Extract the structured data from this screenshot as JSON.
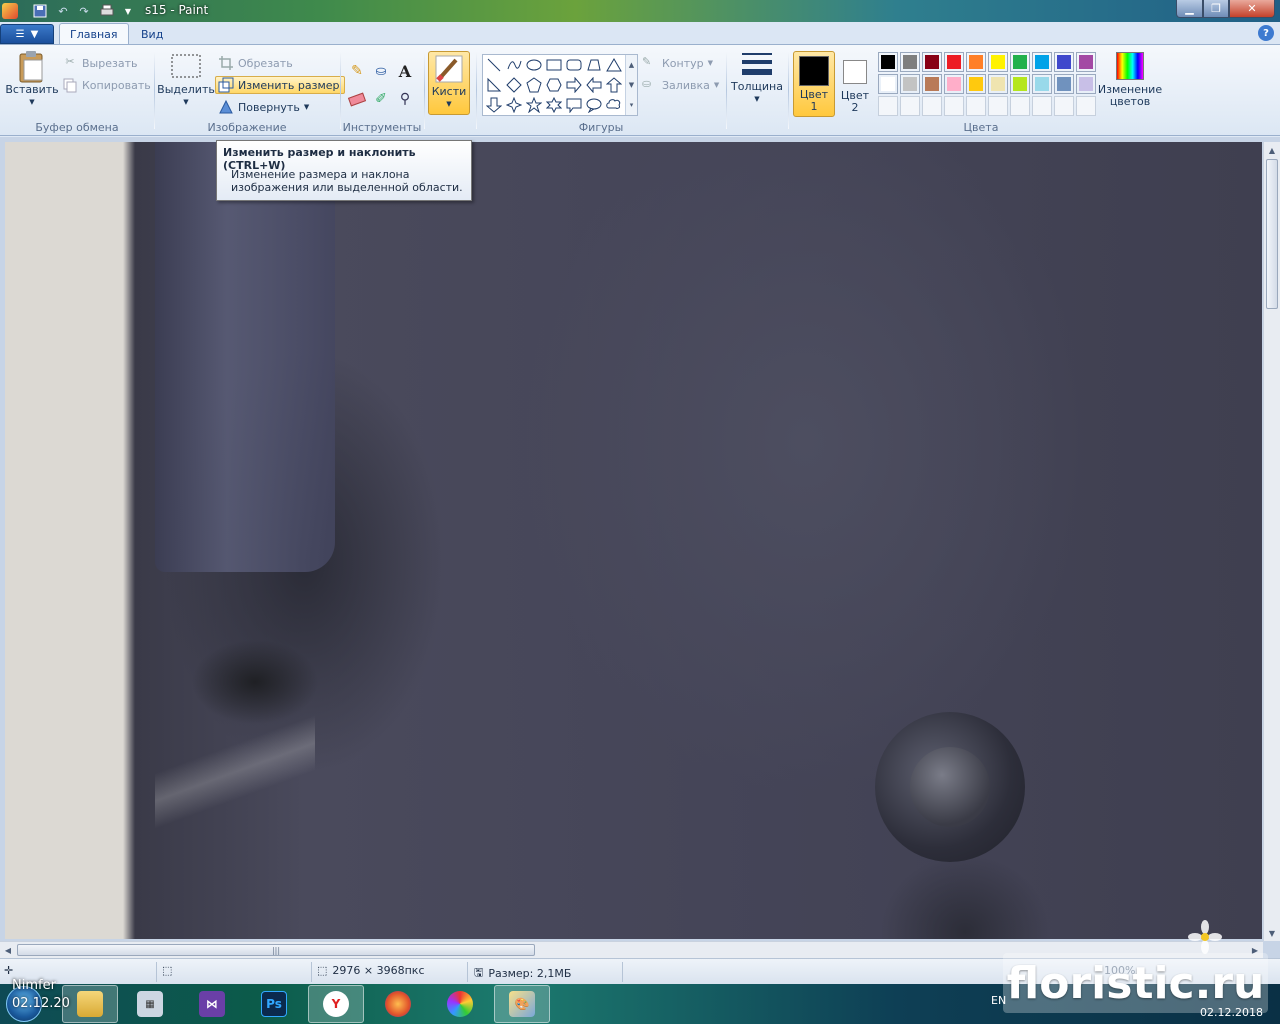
{
  "window": {
    "title": "s15 - Paint",
    "help": "?"
  },
  "tabs": {
    "home": "Главная",
    "view": "Вид"
  },
  "ribbon": {
    "clipboard": {
      "group_label": "Буфер обмена",
      "paste": "Вставить",
      "cut": "Вырезать",
      "copy": "Копировать"
    },
    "image": {
      "group_label": "Изображение",
      "select": "Выделить",
      "crop": "Обрезать",
      "resize": "Изменить размер",
      "rotate": "Повернуть"
    },
    "tools": {
      "group_label": "Инструменты"
    },
    "brushes": {
      "label": "Кисти"
    },
    "shapes": {
      "group_label": "Фигуры",
      "outline": "Контур",
      "fill": "Заливка"
    },
    "size": {
      "label": "Толщина"
    },
    "colors": {
      "group_label": "Цвета",
      "color1_line1": "Цвет",
      "color1_line2": "1",
      "color2_line1": "Цвет",
      "color2_line2": "2",
      "edit_line1": "Изменение",
      "edit_line2": "цветов",
      "color1_value": "#000000",
      "color2_value": "#ffffff",
      "palette_row1": [
        "#000000",
        "#7f7f7f",
        "#880015",
        "#ed1c24",
        "#ff7f27",
        "#fff200",
        "#22b14c",
        "#00a2e8",
        "#3f48cc",
        "#a349a4"
      ],
      "palette_row2": [
        "#ffffff",
        "#c3c3c3",
        "#b97a57",
        "#ffaec9",
        "#ffc90e",
        "#efe4b0",
        "#b5e61d",
        "#99d9ea",
        "#7092be",
        "#c8bfe7"
      ]
    }
  },
  "tooltip": {
    "title": "Изменить размер и наклонить (CTRL+W)",
    "body": "Изменение размера и наклона изображения или выделенной области."
  },
  "statusbar": {
    "dimensions": "2976 × 3968пкс",
    "file_size": "Размер: 2,1МБ",
    "zoom": "100%"
  },
  "desktop": {
    "text1": "Nimfer",
    "text2": "02.12.20"
  },
  "taskbar": {
    "lang": "EN",
    "date": "02.12.2018"
  },
  "watermark": {
    "text": "floristic.ru"
  }
}
